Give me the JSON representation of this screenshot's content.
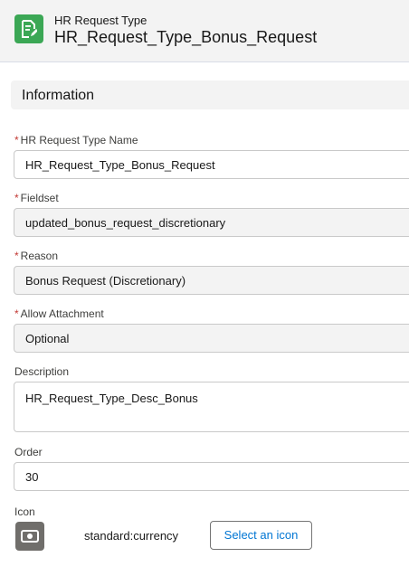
{
  "header": {
    "object_label": "HR Request Type",
    "record_title": "HR_Request_Type_Bonus_Request",
    "icon": "record-edit-icon",
    "icon_color": "#3ba755"
  },
  "section": {
    "title": "Information"
  },
  "fields": {
    "name": {
      "label": "HR Request Type Name",
      "required_marker": "*",
      "value": "HR_Request_Type_Bonus_Request"
    },
    "fieldset": {
      "label": "Fieldset",
      "required_marker": "*",
      "value": "updated_bonus_request_discretionary"
    },
    "reason": {
      "label": "Reason",
      "required_marker": "*",
      "value": "Bonus Request (Discretionary)"
    },
    "allow_attachment": {
      "label": "Allow Attachment",
      "required_marker": "*",
      "value": "Optional"
    },
    "description": {
      "label": "Description",
      "value": "HR_Request_Type_Desc_Bonus"
    },
    "order": {
      "label": "Order",
      "value": "30"
    },
    "icon": {
      "label": "Icon",
      "value": "standard:currency",
      "preview_icon": "currency-icon",
      "select_button": "Select an icon"
    }
  },
  "colors": {
    "required": "#c23934",
    "link": "#0176d3",
    "header_bg": "#f3f3f3"
  }
}
